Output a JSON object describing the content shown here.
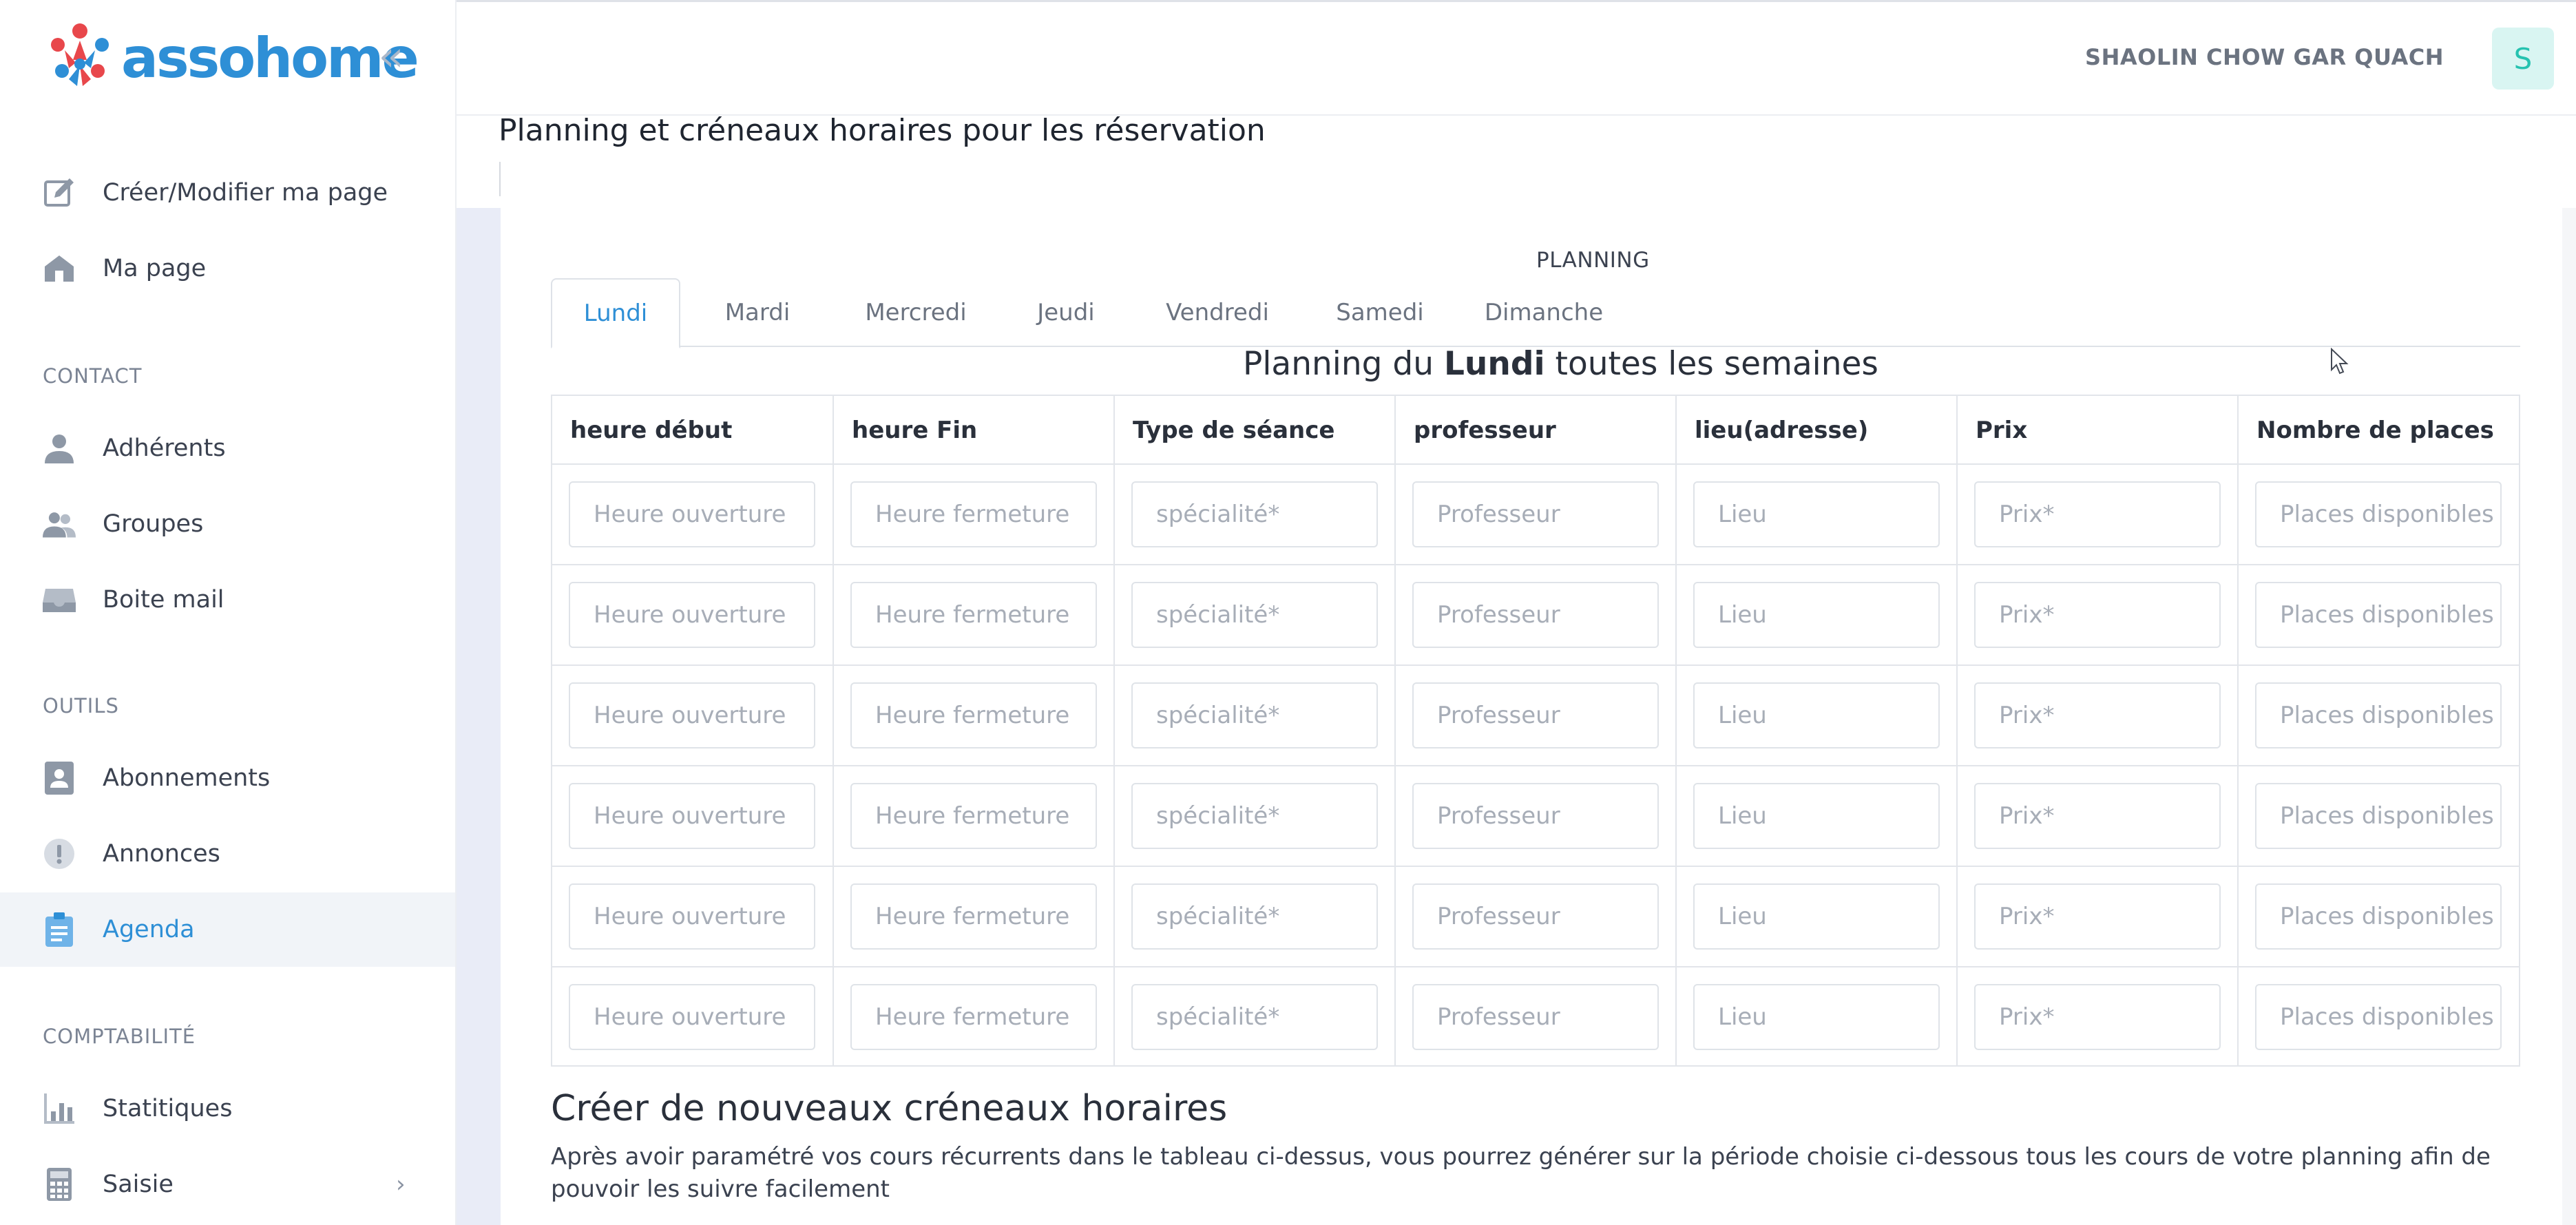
{
  "app": {
    "logo_text": "assohome"
  },
  "sidebar": {
    "collapse_label": "«",
    "items_top": [
      {
        "label": "Créer/Modifier ma page",
        "icon": "edit-icon"
      },
      {
        "label": "Ma page",
        "icon": "home-icon"
      }
    ],
    "sections": [
      {
        "title": "CONTACT",
        "items": [
          {
            "label": "Adhérents",
            "icon": "user-icon"
          },
          {
            "label": "Groupes",
            "icon": "users-icon"
          },
          {
            "label": "Boite mail",
            "icon": "inbox-icon"
          }
        ]
      },
      {
        "title": "OUTILS",
        "items": [
          {
            "label": "Abonnements",
            "icon": "id-card-icon"
          },
          {
            "label": "Annonces",
            "icon": "alert-icon"
          },
          {
            "label": "Agenda",
            "icon": "clipboard-icon",
            "active": true
          }
        ]
      },
      {
        "title": "COMPTABILITÉ",
        "items": [
          {
            "label": "Statitiques",
            "icon": "bar-chart-icon"
          },
          {
            "label": "Saisie",
            "icon": "calculator-icon",
            "chevron": "›"
          }
        ]
      }
    ]
  },
  "header": {
    "user_name": "SHAOLIN CHOW GAR QUACH",
    "avatar_letter": "S"
  },
  "page": {
    "title": "Planning et créneaux horaires pour les réservation",
    "planning_label": "PLANNING",
    "tabs": [
      "Lundi",
      "Mardi",
      "Mercredi",
      "Jeudi",
      "Vendredi",
      "Samedi",
      "Dimanche"
    ],
    "active_tab": "Lundi",
    "heading_prefix": "Planning du ",
    "heading_day": "Lundi",
    "heading_suffix": " toutes les semaines",
    "columns": [
      "heure début",
      "heure Fin",
      "Type de séance",
      "professeur",
      "lieu(adresse)",
      "Prix",
      "Nombre de places"
    ],
    "placeholders": [
      "Heure ouverture",
      "Heure fermeture",
      "spécialité*",
      "Professeur",
      "Lieu",
      "Prix*",
      "Places disponibles"
    ],
    "row_count": 6,
    "new_slots_title": "Créer de nouveaux créneaux horaires",
    "new_slots_desc": "Après avoir paramétré vos cours récurrents dans le tableau ci-dessus, vous pourrez générer sur la période choisie ci-dessous tous les cours de votre planning afin de pouvoir les suivre facilement"
  },
  "colors": {
    "accent": "#2e8fd6",
    "active_bg": "#f1f4f8",
    "avatar_bg": "#d9f5f2",
    "avatar_fg": "#26c2b0"
  }
}
